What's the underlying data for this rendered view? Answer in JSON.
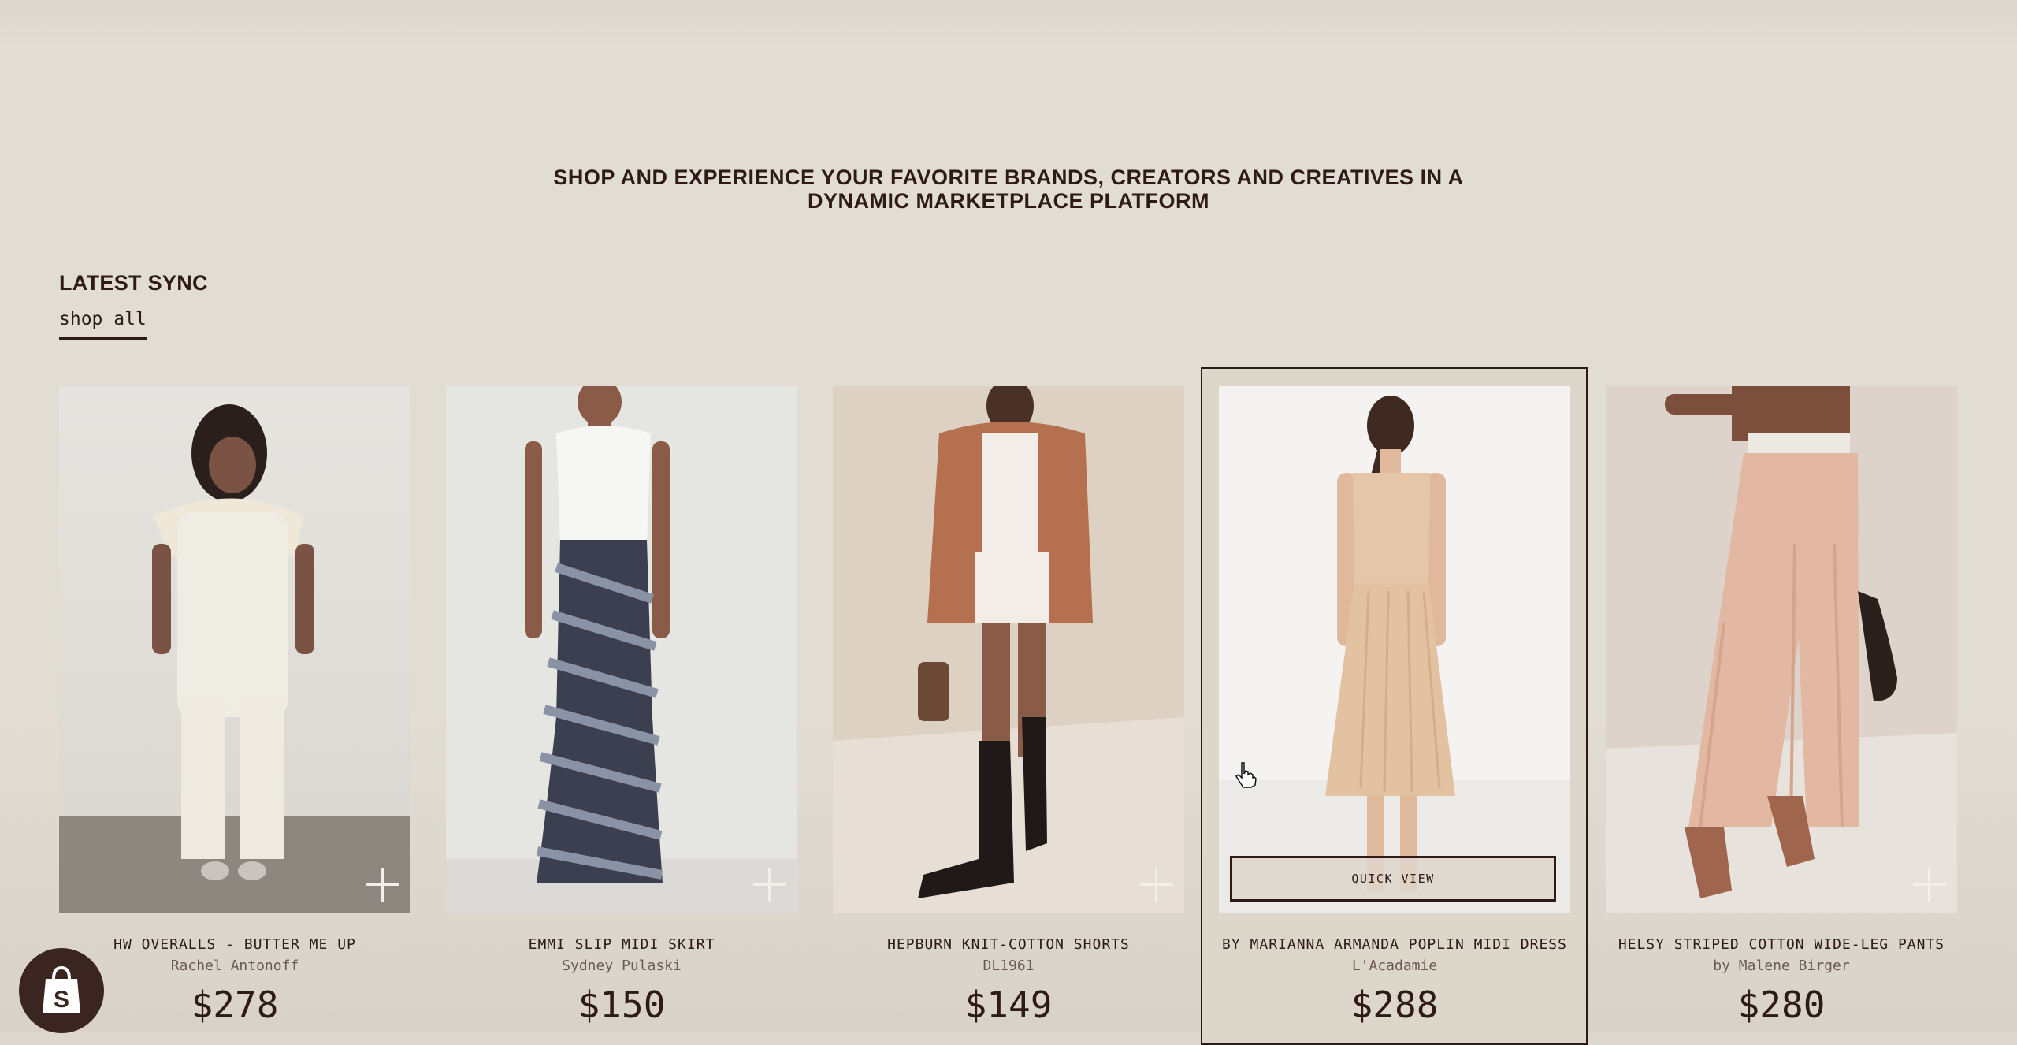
{
  "hero": {
    "line1": "SHOP AND EXPERIENCE YOUR FAVORITE BRANDS, CREATORS AND CREATIVES IN A",
    "line2": "DYNAMIC MARKETPLACE PLATFORM"
  },
  "section": {
    "title": "LATEST SYNC",
    "link": "shop all"
  },
  "products": [
    {
      "name": "HW OVERALLS - BUTTER ME UP",
      "brand": "Rachel Antonoff",
      "price": "$278"
    },
    {
      "name": "EMMI SLIP MIDI SKIRT",
      "brand": "Sydney Pulaski",
      "price": "$150"
    },
    {
      "name": "HEPBURN KNIT-COTTON SHORTS",
      "brand": "DL1961",
      "price": "$149"
    },
    {
      "name": "BY MARIANNA ARMANDA POPLIN MIDI DRESS",
      "brand": "L'Acadamie",
      "price": "$288",
      "quick_view": "QUICK VIEW"
    },
    {
      "name": "HELSY STRIPED COTTON WIDE-LEG PANTS",
      "brand": "by Malene Birger",
      "price": "$280"
    }
  ],
  "icons": {
    "add": "plus-icon",
    "shopify": "shopify-bag-icon",
    "cursor": "hand-pointer-icon"
  },
  "colors": {
    "background": "#e2ddd3",
    "text": "#2e1a17",
    "badge": "#3a2521"
  }
}
